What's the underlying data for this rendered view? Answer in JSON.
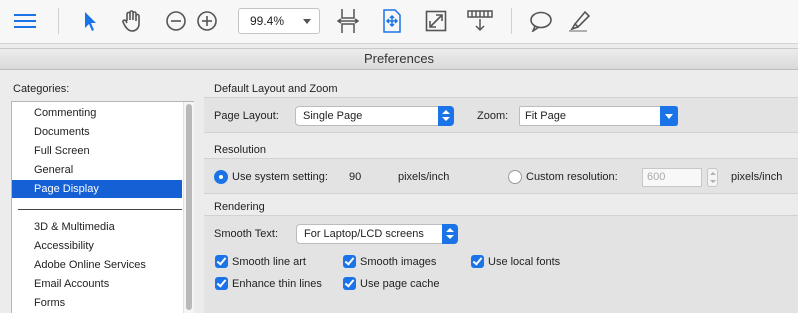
{
  "toolbar": {
    "zoom_value": "99.4%",
    "icons": [
      "menu-icon",
      "select-arrow-icon",
      "hand-icon",
      "zoom-out-icon",
      "zoom-in-icon",
      "fit-width-icon",
      "fit-page-icon",
      "fullscreen-icon",
      "scroll-mode-icon",
      "comment-icon",
      "highlight-icon"
    ],
    "accent": "#1a74e8"
  },
  "window": {
    "title": "Preferences"
  },
  "categories": {
    "label": "Categories:",
    "group1": [
      "Commenting",
      "Documents",
      "Full Screen",
      "General",
      "Page Display"
    ],
    "selected": "Page Display",
    "group2": [
      "3D & Multimedia",
      "Accessibility",
      "Adobe Online Services",
      "Email Accounts",
      "Forms"
    ]
  },
  "layout": {
    "section_title": "Default Layout and Zoom",
    "page_layout_label": "Page Layout:",
    "page_layout_value": "Single Page",
    "zoom_label": "Zoom:",
    "zoom_value": "Fit Page"
  },
  "resolution": {
    "section_title": "Resolution",
    "system_label": "Use system setting:",
    "system_value": "90",
    "unit1": "pixels/inch",
    "custom_label": "Custom resolution:",
    "custom_value": "600",
    "unit2": "pixels/inch"
  },
  "rendering": {
    "section_title": "Rendering",
    "smooth_text_label": "Smooth Text:",
    "smooth_text_value": "For Laptop/LCD screens",
    "options": {
      "smooth_line_art": "Smooth line art",
      "smooth_images": "Smooth images",
      "use_local_fonts": "Use local fonts",
      "enhance_thin_lines": "Enhance thin lines",
      "use_page_cache": "Use page cache"
    }
  }
}
